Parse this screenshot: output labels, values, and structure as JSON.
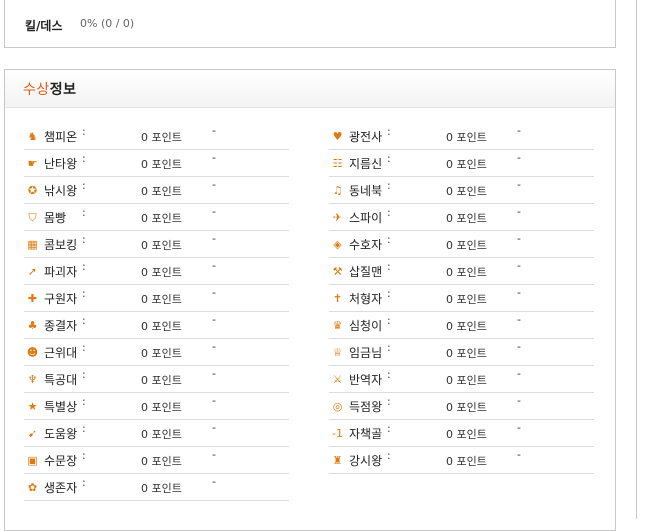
{
  "stats": {
    "killdeath_label": "킬/데스",
    "killdeath_value": "0% (0 / 0)"
  },
  "awards": {
    "title_accent": "수상",
    "title_rest": "정보",
    "left": [
      {
        "name": "챔피온",
        "colon": ":",
        "points": "0 포인트",
        "extra": "-",
        "icon": "trophy-icon",
        "glyph": "♞"
      },
      {
        "name": "난타왕",
        "colon": ":",
        "points": "0 포인트",
        "extra": "-",
        "icon": "gun-icon",
        "glyph": "☛"
      },
      {
        "name": "낚시왕",
        "colon": ":",
        "points": "0 포인트",
        "extra": "-",
        "icon": "fish-icon",
        "glyph": "✪"
      },
      {
        "name": "몸빵",
        "colon": ":",
        "points": "0 포인트",
        "extra": "-",
        "icon": "shield-icon",
        "glyph": "⛉"
      },
      {
        "name": "콤보킹",
        "colon": ":",
        "points": "0 포인트",
        "extra": "-",
        "icon": "combo-icon",
        "glyph": "▦"
      },
      {
        "name": "파괴자",
        "colon": ":",
        "points": "0 포인트",
        "extra": "-",
        "icon": "arrow-icon",
        "glyph": "➚"
      },
      {
        "name": "구원자",
        "colon": ":",
        "points": "0 포인트",
        "extra": "-",
        "icon": "medkit-icon",
        "glyph": "✚"
      },
      {
        "name": "종결자",
        "colon": ":",
        "points": "0 포인트",
        "extra": "-",
        "icon": "bell-icon",
        "glyph": "♣"
      },
      {
        "name": "근위대",
        "colon": ":",
        "points": "0 포인트",
        "extra": "-",
        "icon": "helmet-icon",
        "glyph": "☻"
      },
      {
        "name": "특공대",
        "colon": ":",
        "points": "0 포인트",
        "extra": "-",
        "icon": "wings-icon",
        "glyph": "♆"
      },
      {
        "name": "특별상",
        "colon": ":",
        "points": "0 포인트",
        "extra": "-",
        "icon": "star-icon",
        "glyph": "★"
      },
      {
        "name": "도움왕",
        "colon": ":",
        "points": "0 포인트",
        "extra": "-",
        "icon": "boot-icon",
        "glyph": "➹"
      },
      {
        "name": "수문장",
        "colon": ":",
        "points": "0 포인트",
        "extra": "-",
        "icon": "gate-icon",
        "glyph": "▣"
      },
      {
        "name": "생존자",
        "colon": ":",
        "points": "0 포인트",
        "extra": "-",
        "icon": "medal-icon",
        "glyph": "✿"
      }
    ],
    "right": [
      {
        "name": "광전사",
        "colon": ":",
        "points": "0 포인트",
        "extra": "-",
        "icon": "axe-icon",
        "glyph": "♥"
      },
      {
        "name": "지름신",
        "colon": ":",
        "points": "0 포인트",
        "extra": "-",
        "icon": "box-icon",
        "glyph": "☷"
      },
      {
        "name": "동네북",
        "colon": ":",
        "points": "0 포인트",
        "extra": "-",
        "icon": "drum-icon",
        "glyph": "♫"
      },
      {
        "name": "스파이",
        "colon": ":",
        "points": "0 포인트",
        "extra": "-",
        "icon": "spy-icon",
        "glyph": "✈"
      },
      {
        "name": "수호자",
        "colon": ":",
        "points": "0 포인트",
        "extra": "-",
        "icon": "diamond-icon",
        "glyph": "◈"
      },
      {
        "name": "삽질맨",
        "colon": ":",
        "points": "0 포인트",
        "extra": "-",
        "icon": "shovel-icon",
        "glyph": "⚒"
      },
      {
        "name": "처형자",
        "colon": ":",
        "points": "0 포인트",
        "extra": "-",
        "icon": "cross-icon",
        "glyph": "✝"
      },
      {
        "name": "심청이",
        "colon": ":",
        "points": "0 포인트",
        "extra": "-",
        "icon": "wave-icon",
        "glyph": "♛"
      },
      {
        "name": "임금님",
        "colon": ":",
        "points": "0 포인트",
        "extra": "-",
        "icon": "crown-icon",
        "glyph": "♕"
      },
      {
        "name": "반역자",
        "colon": ":",
        "points": "0 포인트",
        "extra": "-",
        "icon": "dagger-icon",
        "glyph": "⚔"
      },
      {
        "name": "득점왕",
        "colon": ":",
        "points": "0 포인트",
        "extra": "-",
        "icon": "target-icon",
        "glyph": "◎"
      },
      {
        "name": "자책골",
        "colon": ":",
        "points": "0 포인트",
        "extra": "-",
        "icon": "minus-one-icon",
        "glyph": "-1"
      },
      {
        "name": "강시왕",
        "colon": ":",
        "points": "0 포인트",
        "extra": "-",
        "icon": "ghost-icon",
        "glyph": "♜"
      }
    ]
  }
}
